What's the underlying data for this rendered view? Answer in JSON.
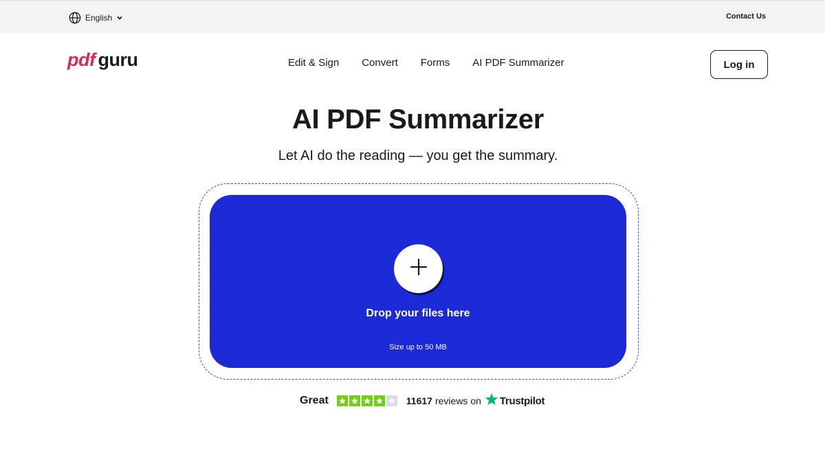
{
  "topbar": {
    "language": "English",
    "contact": "Contact Us"
  },
  "header": {
    "logo_pdf": "pdf",
    "logo_guru": "guru",
    "nav": [
      "Edit & Sign",
      "Convert",
      "Forms",
      "AI PDF Summarizer"
    ],
    "login": "Log in"
  },
  "hero": {
    "title": "AI PDF Summarizer",
    "subtitle": "Let AI do the reading — you get the summary."
  },
  "dropzone": {
    "text": "Drop your files here",
    "size": "Size up to 50 MB"
  },
  "rating": {
    "word": "Great",
    "stars_filled": 4,
    "stars_total": 5,
    "count": "11617",
    "reviews_on": "reviews on",
    "brand": "Trustpilot"
  },
  "colors": {
    "brand_red": "#e0284f",
    "drop_blue": "#1b2ad6",
    "star_green": "#73cf11",
    "trustpilot_green": "#00b67a"
  }
}
